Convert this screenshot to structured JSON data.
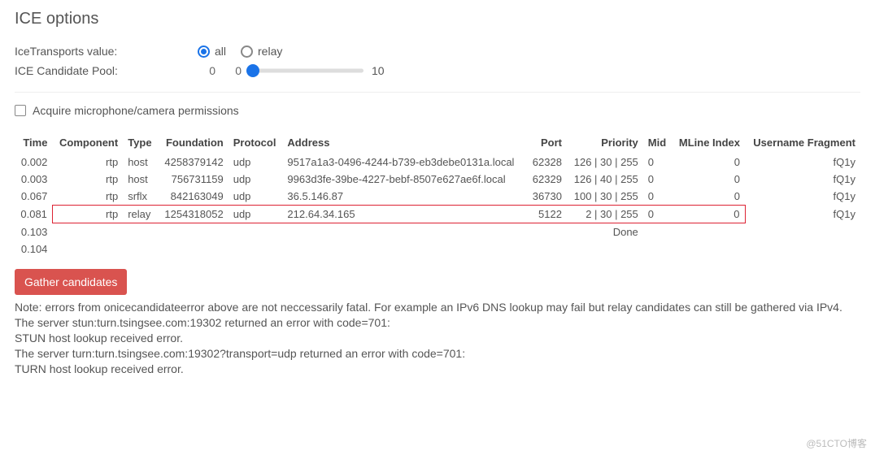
{
  "title": "ICE options",
  "form": {
    "transports_label": "IceTransports value:",
    "pool_label": "ICE Candidate Pool:",
    "radio_all": "all",
    "radio_relay": "relay",
    "pool_current": "0",
    "slider_min": "0",
    "slider_max": "10"
  },
  "checkbox_label": "Acquire microphone/camera permissions",
  "columns": {
    "time": "Time",
    "component": "Component",
    "type": "Type",
    "foundation": "Foundation",
    "protocol": "Protocol",
    "address": "Address",
    "port": "Port",
    "priority": "Priority",
    "mid": "Mid",
    "mline": "MLine Index",
    "ufrag": "Username Fragment"
  },
  "rows": [
    {
      "time": "0.002",
      "component": "rtp",
      "type": "host",
      "foundation": "4258379142",
      "protocol": "udp",
      "address": "9517a1a3-0496-4244-b739-eb3debe0131a.local",
      "port": "62328",
      "priority": "126 | 30 | 255",
      "mid": "0",
      "mline": "0",
      "ufrag": "fQ1y",
      "hl": false
    },
    {
      "time": "0.003",
      "component": "rtp",
      "type": "host",
      "foundation": "756731159",
      "protocol": "udp",
      "address": "9963d3fe-39be-4227-bebf-8507e627ae6f.local",
      "port": "62329",
      "priority": "126 | 40 | 255",
      "mid": "0",
      "mline": "0",
      "ufrag": "fQ1y",
      "hl": false
    },
    {
      "time": "0.067",
      "component": "rtp",
      "type": "srflx",
      "foundation": "842163049",
      "protocol": "udp",
      "address": "36.5.146.87",
      "port": "36730",
      "priority": "100 | 30 | 255",
      "mid": "0",
      "mline": "0",
      "ufrag": "fQ1y",
      "hl": false
    },
    {
      "time": "0.081",
      "component": "rtp",
      "type": "relay",
      "foundation": "1254318052",
      "protocol": "udp",
      "address": "212.64.34.165",
      "port": "5122",
      "priority": "2 | 30 | 255",
      "mid": "0",
      "mline": "0",
      "ufrag": "fQ1y",
      "hl": true
    },
    {
      "time": "0.103",
      "component": "",
      "type": "",
      "foundation": "",
      "protocol": "",
      "address": "",
      "port": "",
      "priority": "Done",
      "mid": "",
      "mline": "",
      "ufrag": "",
      "hl": false
    },
    {
      "time": "0.104",
      "component": "",
      "type": "",
      "foundation": "",
      "protocol": "",
      "address": "",
      "port": "",
      "priority": "",
      "mid": "",
      "mline": "",
      "ufrag": "",
      "hl": false
    }
  ],
  "button_label": "Gather candidates",
  "notes": [
    "Note: errors from onicecandidateerror above are not neccessarily fatal. For example an IPv6 DNS lookup may fail but relay candidates can still be gathered via IPv4.",
    "The server stun:turn.tsingsee.com:19302 returned an error with code=701:",
    "STUN host lookup received error.",
    "The server turn:turn.tsingsee.com:19302?transport=udp returned an error with code=701:",
    "TURN host lookup received error."
  ],
  "watermark": "@51CTO博客"
}
